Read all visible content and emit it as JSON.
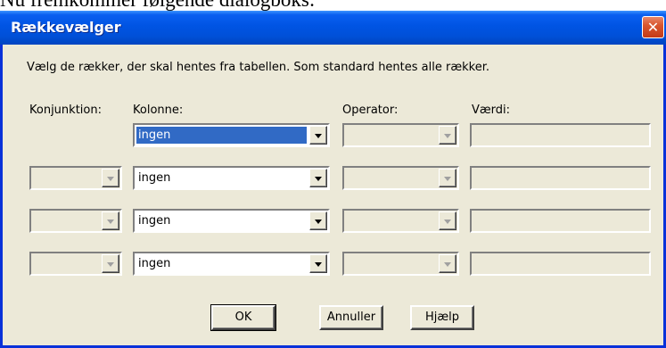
{
  "document": {
    "text": "Nu fremkommer følgende dialogboks:"
  },
  "dialog": {
    "title": "Rækkevælger",
    "close_symbol": "✕",
    "instruction": "Vælg de rækker, der skal hentes fra tabellen. Som standard hentes alle rækker.",
    "headers": {
      "conjunction": "Konjunktion:",
      "column": "Kolonne:",
      "operator": "Operator:",
      "value": "Værdi:"
    },
    "rows": [
      {
        "conjunction": "",
        "column": "ingen",
        "operator": "",
        "value": ""
      },
      {
        "conjunction": "",
        "column": "ingen",
        "operator": "",
        "value": ""
      },
      {
        "conjunction": "",
        "column": "ingen",
        "operator": "",
        "value": ""
      },
      {
        "conjunction": "",
        "column": "ingen",
        "operator": "",
        "value": ""
      }
    ],
    "buttons": {
      "ok": "OK",
      "cancel": "Annuller",
      "help": "Hjælp"
    }
  },
  "icons": {
    "close": "close-icon",
    "dropdown": "chevron-down-icon"
  },
  "colors": {
    "titlebar": "#0054e3",
    "dialog_bg": "#ece9d8",
    "selection": "#316ac5",
    "close_button": "#d9572f"
  }
}
